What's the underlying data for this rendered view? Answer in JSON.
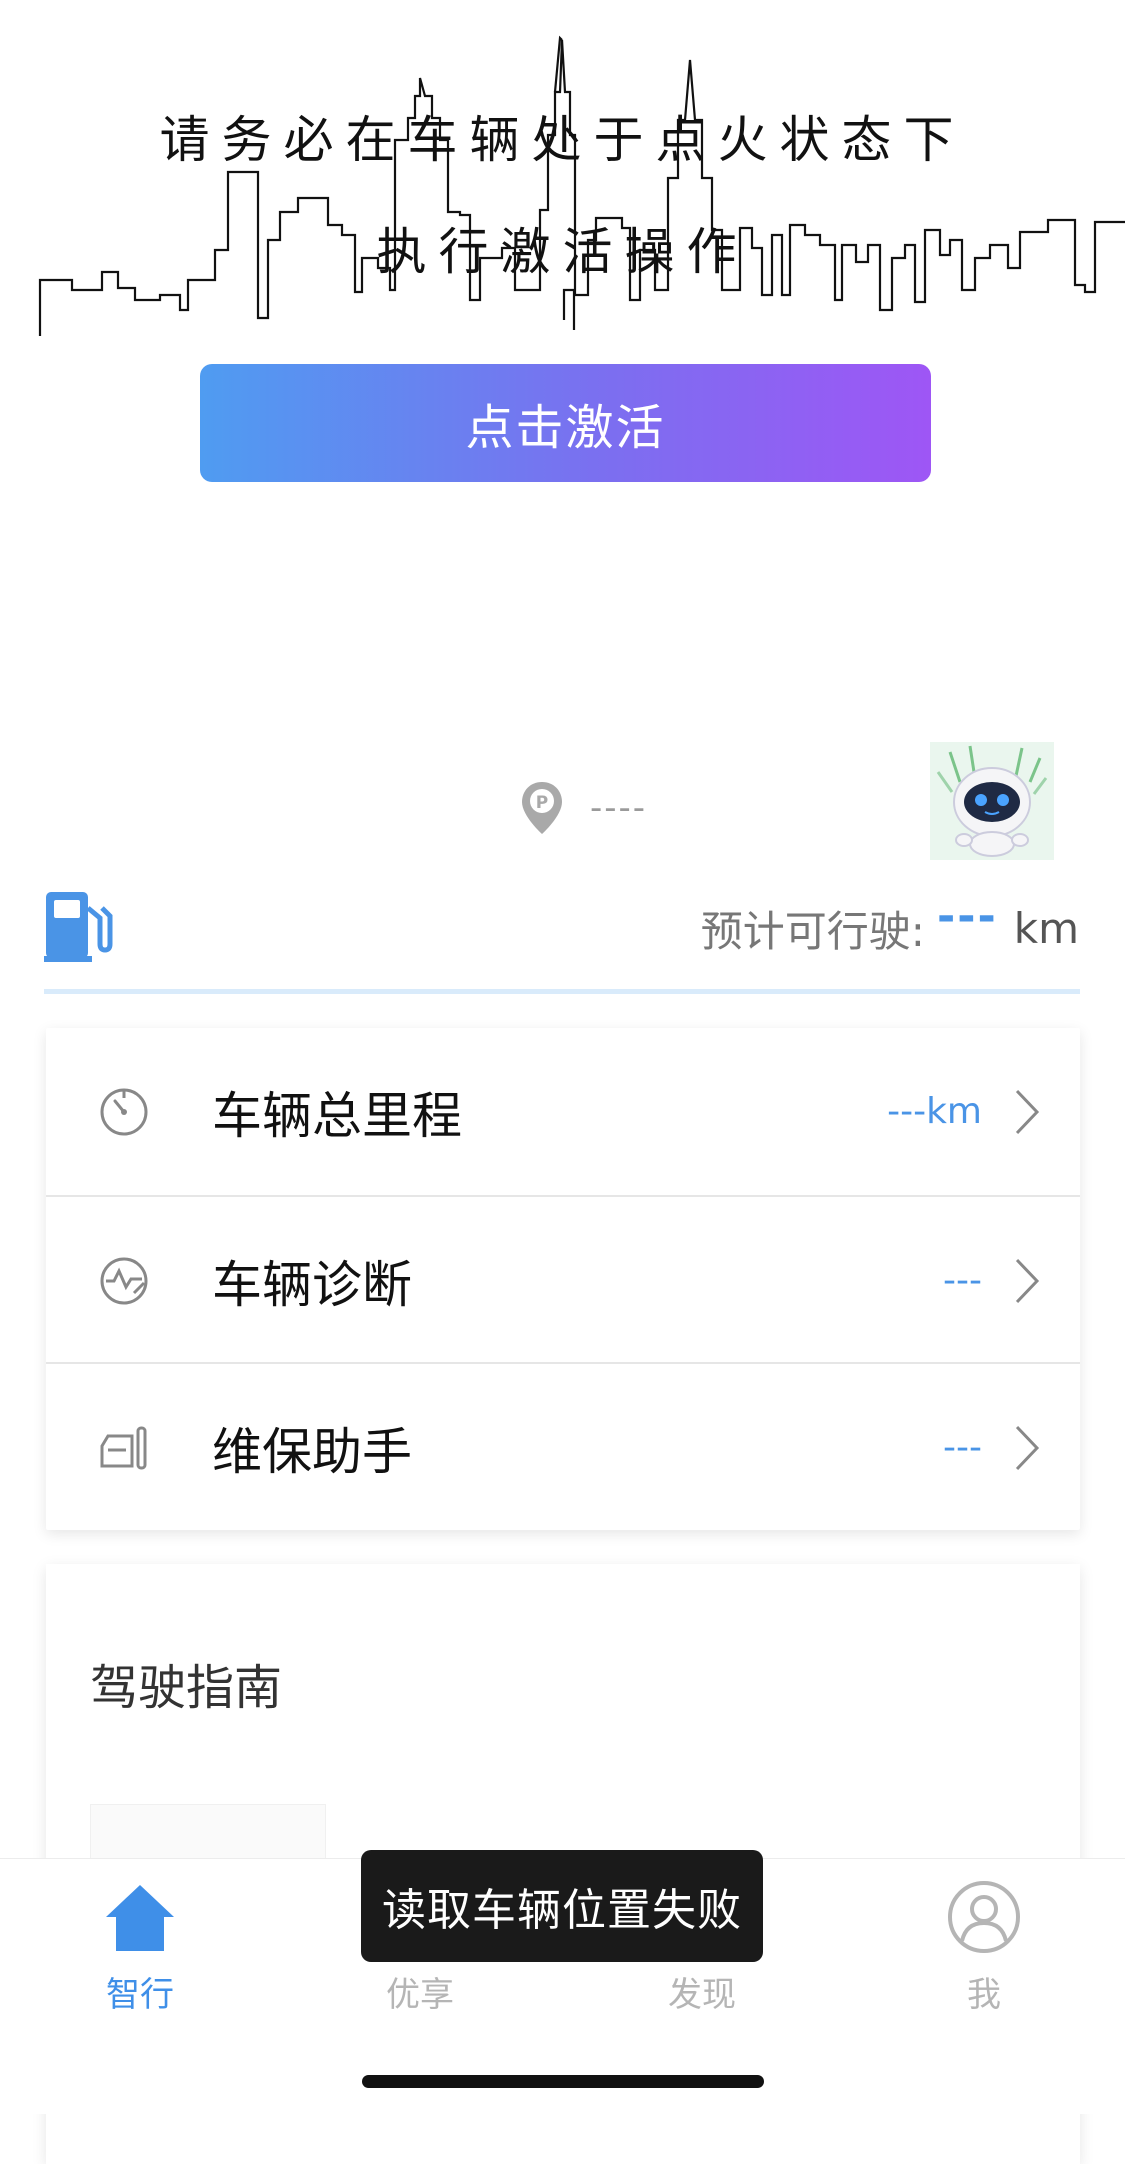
{
  "hero": {
    "line1": "请务必在车辆处于点火状态下",
    "line2": "执行激活操作",
    "button_label": "点击激活"
  },
  "parking": {
    "text": "----"
  },
  "range": {
    "label": "预计可行驶:",
    "value": "---",
    "unit": "km"
  },
  "stats": [
    {
      "label": "车辆总里程",
      "value": "---km",
      "icon": "speedometer-icon"
    },
    {
      "label": "车辆诊断",
      "value": "---",
      "icon": "diagnosis-icon"
    },
    {
      "label": "维保助手",
      "value": "---",
      "icon": "maintenance-icon"
    }
  ],
  "guide": {
    "title": "驾驶指南"
  },
  "tabs": [
    {
      "label": "智行",
      "icon": "home-icon",
      "active": true
    },
    {
      "label": "优享",
      "icon": "shop-icon",
      "active": false
    },
    {
      "label": "发现",
      "icon": "discover-icon",
      "active": false
    },
    {
      "label": "我",
      "icon": "profile-icon",
      "active": false
    }
  ],
  "toast": "读取车辆位置失败",
  "colors": {
    "accent": "#4a94e6",
    "button_gradient_start": "#4f9cf1",
    "button_gradient_end": "#9e56f5",
    "tab_active": "#3f8fe8",
    "tab_inactive": "#b5b5b5"
  }
}
